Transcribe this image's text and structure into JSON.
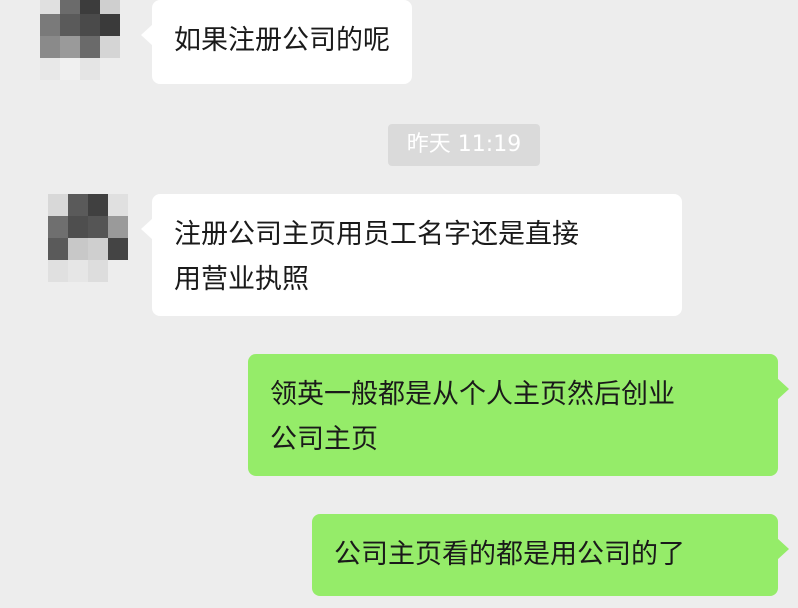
{
  "messages": [
    {
      "direction": "incoming",
      "lines": [
        "如果注册公司的呢"
      ]
    },
    {
      "direction": "incoming",
      "lines": [
        "注册公司主页用员工名字还是直接",
        "用营业执照"
      ]
    },
    {
      "direction": "outgoing",
      "lines": [
        "领英一般都是从个人主页然后创业",
        "公司主页"
      ]
    },
    {
      "direction": "outgoing",
      "lines": [
        "公司主页看的都是用公司的了"
      ]
    }
  ],
  "timestamp": "昨天 11:19",
  "colors": {
    "background": "#ededed",
    "incoming_bubble": "#ffffff",
    "outgoing_bubble": "#95ec69",
    "timestamp_badge": "#dadada"
  }
}
